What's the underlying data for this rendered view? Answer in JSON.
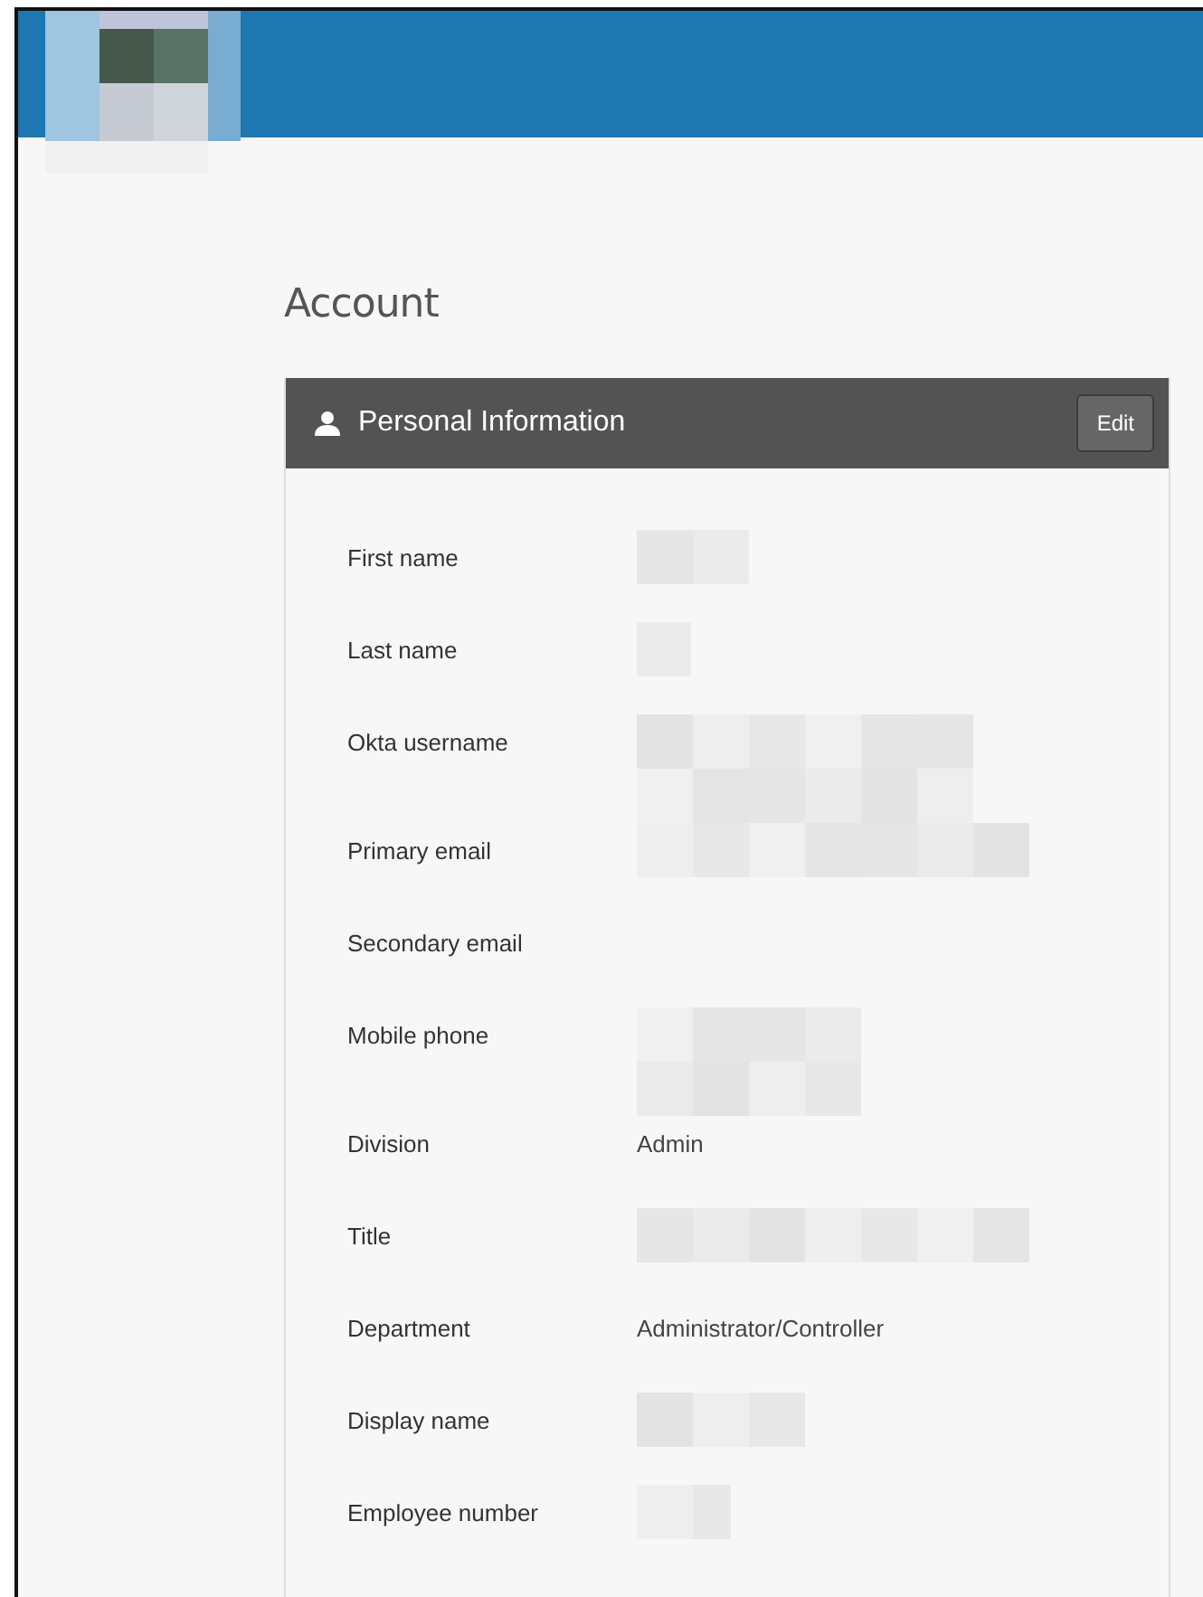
{
  "page_title": "Account",
  "panel": {
    "title": "Personal Information",
    "edit_button": "Edit",
    "fields": [
      {
        "label": "First name",
        "kind": "redacted"
      },
      {
        "label": "Last name",
        "kind": "redacted"
      },
      {
        "label": "Okta username",
        "kind": "redacted"
      },
      {
        "label": "Primary email",
        "kind": "redacted"
      },
      {
        "label": "Secondary email",
        "kind": "empty"
      },
      {
        "label": "Mobile phone",
        "kind": "redacted"
      },
      {
        "label": "Division",
        "kind": "text",
        "value": "Admin"
      },
      {
        "label": "Title",
        "kind": "redacted"
      },
      {
        "label": "Department",
        "kind": "text",
        "value": "Administrator/Controller"
      },
      {
        "label": "Display name",
        "kind": "redacted"
      },
      {
        "label": "Employee number",
        "kind": "redacted"
      }
    ]
  }
}
